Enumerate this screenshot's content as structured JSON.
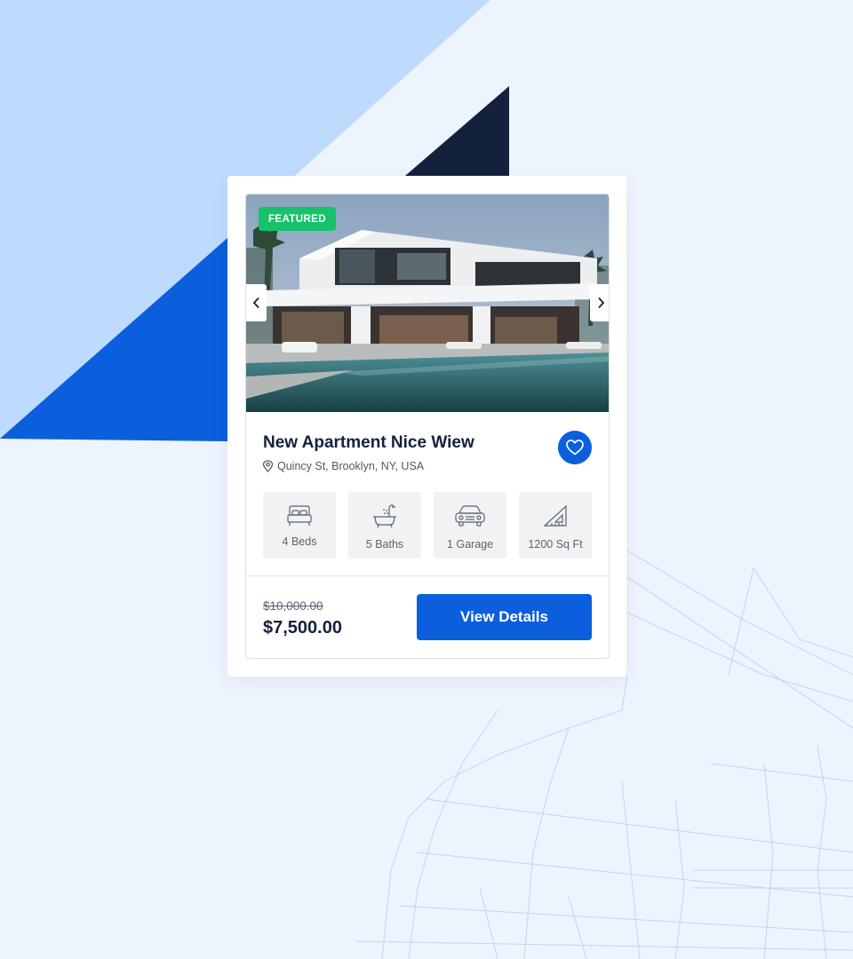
{
  "listing": {
    "badge": "FEATURED",
    "title": "New Apartment Nice Wiew",
    "location": "Quincy St, Brooklyn, NY, USA",
    "features": [
      {
        "icon": "bed-icon",
        "label": "4 Beds"
      },
      {
        "icon": "bathtub-icon",
        "label": "5 Baths"
      },
      {
        "icon": "car-icon",
        "label": "1 Garage"
      },
      {
        "icon": "ruler-triangle-icon",
        "label": "1200 Sq Ft"
      }
    ],
    "old_price": "$10,000.00",
    "price": "$7,500.00",
    "cta_label": "View Details"
  },
  "colors": {
    "background": "#edf4fe",
    "accent": "#0b5fdc",
    "badge": "#17c26b",
    "navy": "#14213d"
  }
}
